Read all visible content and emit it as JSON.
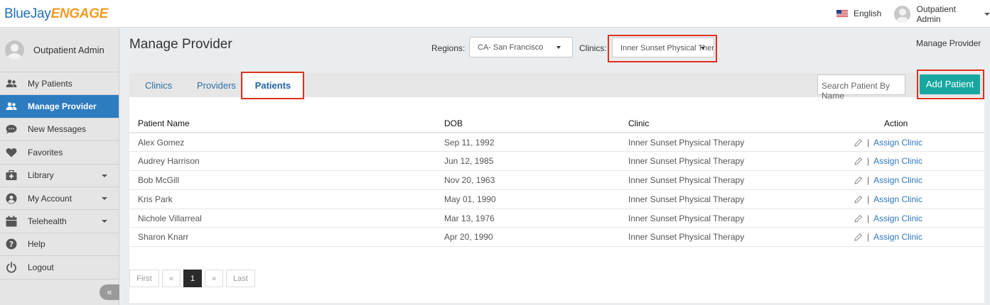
{
  "brand": {
    "part1": "BlueJay",
    "part2": "ENGAGE"
  },
  "header": {
    "language": "English",
    "user": "Outpatient Admin"
  },
  "sidebar": {
    "user": "Outpatient Admin",
    "items": [
      {
        "label": "My Patients",
        "icon": "users-icon"
      },
      {
        "label": "Manage Provider",
        "icon": "users-icon"
      },
      {
        "label": "New Messages",
        "icon": "chat-icon"
      },
      {
        "label": "Favorites",
        "icon": "heart-icon"
      },
      {
        "label": "Library",
        "icon": "medkit-icon"
      },
      {
        "label": "My Account",
        "icon": "user-circle-icon"
      },
      {
        "label": "Telehealth",
        "icon": "calendar-icon"
      },
      {
        "label": "Help",
        "icon": "question-icon"
      },
      {
        "label": "Logout",
        "icon": "power-icon"
      }
    ],
    "collapse_glyph": "«"
  },
  "page": {
    "title": "Manage Provider",
    "breadcrumb": "Manage Provider",
    "regions_label": "Regions:",
    "region_value": "CA- San Francisco",
    "clinics_label": "Clinics:",
    "clinic_value": "Inner Sunset Physical Thera"
  },
  "tabs": [
    {
      "label": "Clinics"
    },
    {
      "label": "Providers"
    },
    {
      "label": "Patients"
    }
  ],
  "search": {
    "placeholder": "Search Patient By Name"
  },
  "add_button": "Add Patient",
  "table": {
    "headers": [
      "Patient Name",
      "DOB",
      "Clinic",
      "Action"
    ],
    "action_link": "Assign Clinic",
    "action_sep": "|",
    "rows": [
      {
        "name": "Alex Gomez",
        "dob": "Sep 11, 1992",
        "clinic": "Inner Sunset Physical Therapy"
      },
      {
        "name": "Audrey Harrison",
        "dob": "Jun 12, 1985",
        "clinic": "Inner Sunset Physical Therapy"
      },
      {
        "name": "Bob McGill",
        "dob": "Nov 20, 1963",
        "clinic": "Inner Sunset Physical Therapy"
      },
      {
        "name": "Kris Park",
        "dob": "May 01, 1990",
        "clinic": "Inner Sunset Physical Therapy"
      },
      {
        "name": "Nichole Villarreal",
        "dob": "Mar 13, 1976",
        "clinic": "Inner Sunset Physical Therapy"
      },
      {
        "name": "Sharon Knarr",
        "dob": "Apr 20, 1990",
        "clinic": "Inner Sunset Physical Therapy"
      }
    ]
  },
  "pagination": {
    "first": "First",
    "prev": "«",
    "current": "1",
    "next": "»",
    "last": "Last"
  },
  "colors": {
    "accent": "#2d7cc0",
    "add": "#17a7a0",
    "highlight": "#e0301e"
  }
}
